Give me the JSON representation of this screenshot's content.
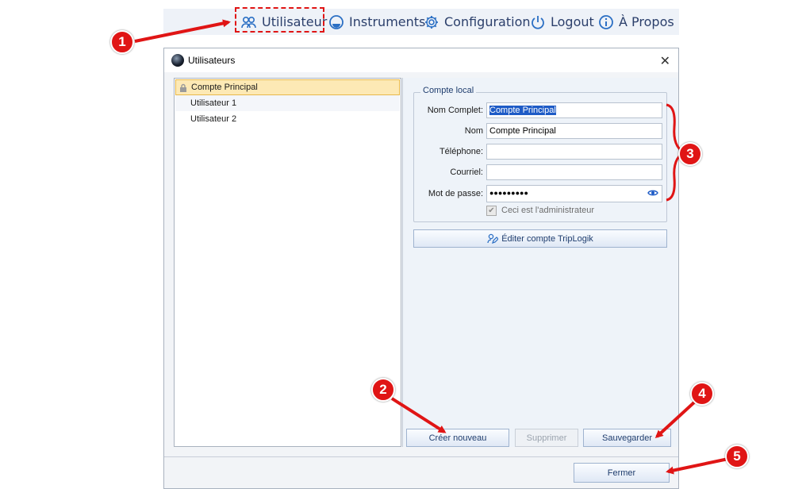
{
  "menu": {
    "items": [
      {
        "label": "Utilisateur",
        "icon": "users-icon"
      },
      {
        "label": "Instruments",
        "icon": "gauge-icon"
      },
      {
        "label": "Configuration",
        "icon": "gear-icon"
      },
      {
        "label": "Logout",
        "icon": "power-icon"
      },
      {
        "label": "À Propos",
        "icon": "info-icon"
      }
    ]
  },
  "dialog": {
    "title": "Utilisateurs",
    "users": [
      "Compte Principal",
      "Utilisateur 1",
      "Utilisateur 2"
    ],
    "selected_user": "Compte Principal",
    "group_title": "Compte local",
    "fields": {
      "full_name": {
        "label": "Nom Complet:",
        "value": "Compte Principal"
      },
      "name": {
        "label": "Nom",
        "value": "Compte Principal"
      },
      "phone": {
        "label": "Téléphone:",
        "value": ""
      },
      "email": {
        "label": "Courriel:",
        "value": ""
      },
      "password": {
        "label": "Mot de passe:",
        "value": "●●●●●●●●●"
      }
    },
    "admin_checkbox": {
      "label": "Ceci est l'administrateur",
      "checked": true,
      "enabled": false
    },
    "triplogik_button": "Éditer compte TripLogik",
    "buttons": {
      "create": "Créer nouveau",
      "delete": "Supprimer",
      "save": "Sauvegarder",
      "close": "Fermer"
    }
  },
  "callouts": [
    "1",
    "2",
    "3",
    "4",
    "5"
  ],
  "colors": {
    "callout": "#e01515",
    "accent": "#1f3d6e",
    "selection": "#fde9b5"
  }
}
